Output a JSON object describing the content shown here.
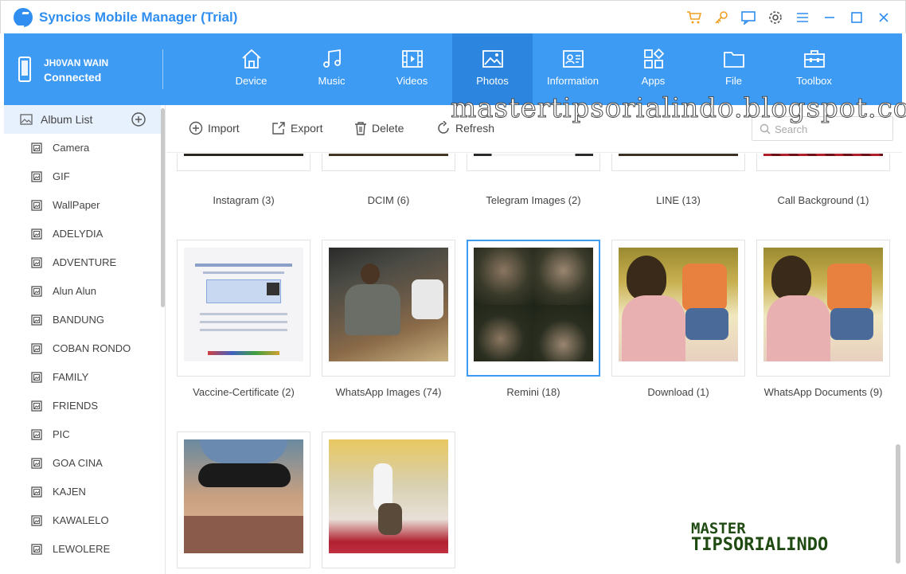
{
  "app": {
    "title": "Syncios Mobile Manager (Trial)"
  },
  "device": {
    "name": "JH0VAN WAIN",
    "status": "Connected"
  },
  "nav": {
    "tabs": [
      "Device",
      "Music",
      "Videos",
      "Photos",
      "Information",
      "Apps",
      "File",
      "Toolbox"
    ],
    "active": "Photos"
  },
  "sidebar": {
    "header": "Album List",
    "items": [
      "Camera",
      "GIF",
      "WallPaper",
      "ADELYDIA",
      "ADVENTURE",
      "Alun Alun",
      "BANDUNG",
      "COBAN RONDO",
      "FAMILY",
      "FRIENDS",
      "PIC",
      "GOA CINA",
      "KAJEN",
      "KAWALELO",
      "LEWOLERE"
    ]
  },
  "toolbar": {
    "import": "Import",
    "export": "Export",
    "delete": "Delete",
    "refresh": "Refresh",
    "search_placeholder": "Search"
  },
  "albums_row1": [
    "Instagram (3)",
    "DCIM (6)",
    "Telegram Images (2)",
    "LINE (13)",
    "Call Background (1)"
  ],
  "albums_row2": [
    "Vaccine-Certificate (2)",
    "WhatsApp Images (74)",
    "Remini (18)",
    "Download (1)",
    "WhatsApp Documents (9)"
  ],
  "selected_album": "Remini (18)",
  "watermark": "mastertipsorialindo.blogspot.com",
  "brand": {
    "line1": "MASTER",
    "line2": "TIPSORIALINDO"
  },
  "colors": {
    "accent": "#3d9bf3",
    "active_tab": "#2c86e0",
    "title": "#2f8ef0",
    "cart": "#f0a020"
  }
}
